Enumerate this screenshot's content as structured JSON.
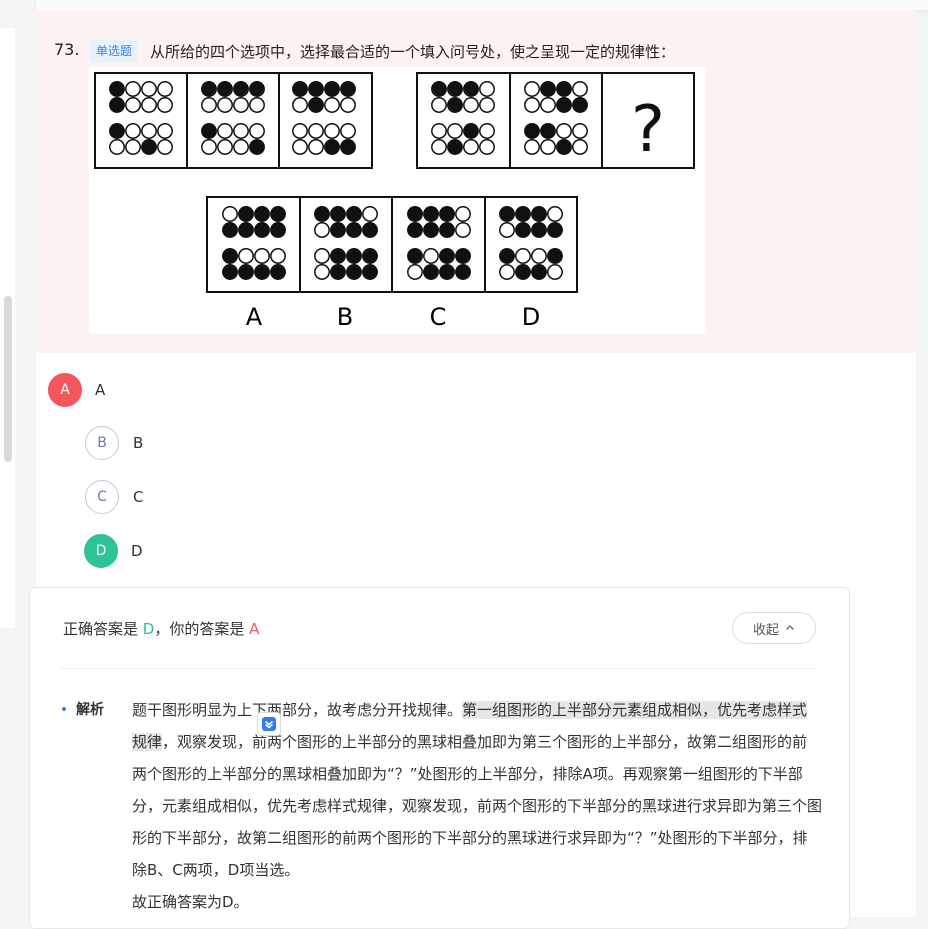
{
  "question": {
    "number": "73.",
    "type_tag": "单选题",
    "text": "从所给的四个选项中，选择最合适的一个填入问号处，使之呈现一定的规律性：",
    "figure_question_mark": "?",
    "figure_option_labels": [
      "A",
      "B",
      "C",
      "D"
    ]
  },
  "options": [
    {
      "letter": "A",
      "text": "A",
      "state": "wrong"
    },
    {
      "letter": "B",
      "text": "B",
      "state": "normal"
    },
    {
      "letter": "C",
      "text": "C",
      "state": "normal"
    },
    {
      "letter": "D",
      "text": "D",
      "state": "right"
    }
  ],
  "answer": {
    "prefix": "正确答案是 ",
    "correct": "D",
    "middle": "，你的答案是 ",
    "user": "A",
    "collapse_label": "收起",
    "collapse_icon": "chevron-up-icon"
  },
  "analysis": {
    "title": "解析",
    "p1_a": "题干图形明显",
    "p1_b": "为上下两部分，故考虑分开找规律。",
    "p1_hl": "第一组图形的上半部分元素组成相似，优先考虑样式规律",
    "p1_c": "，观察发现，前两个图形的上半部分的黑球相叠加即为第三个图形的上半部分，故第二组图形的前两个图形的上半部分的黑球相叠加即为“？”处图形的上半部分，排除A项。再观察第一组图形的下半部分，元素组成相似，优先考虑样式规律，观察发现，前两个图形的下半部分的黑球进行求异即为第三个图形的下半部分，故第二组图形的前两个图形的下半部分的黑球进行求异即为“？”处图形的下半部分，排除B、C两项，D项当选。",
    "p2": "故正确答案为D。"
  },
  "colors": {
    "question_bg": "#fdf2f2",
    "tag_bg": "#e8f1fe",
    "tag_text": "#3b7ef0",
    "wrong": "#f4575b",
    "correct": "#2ec396"
  }
}
